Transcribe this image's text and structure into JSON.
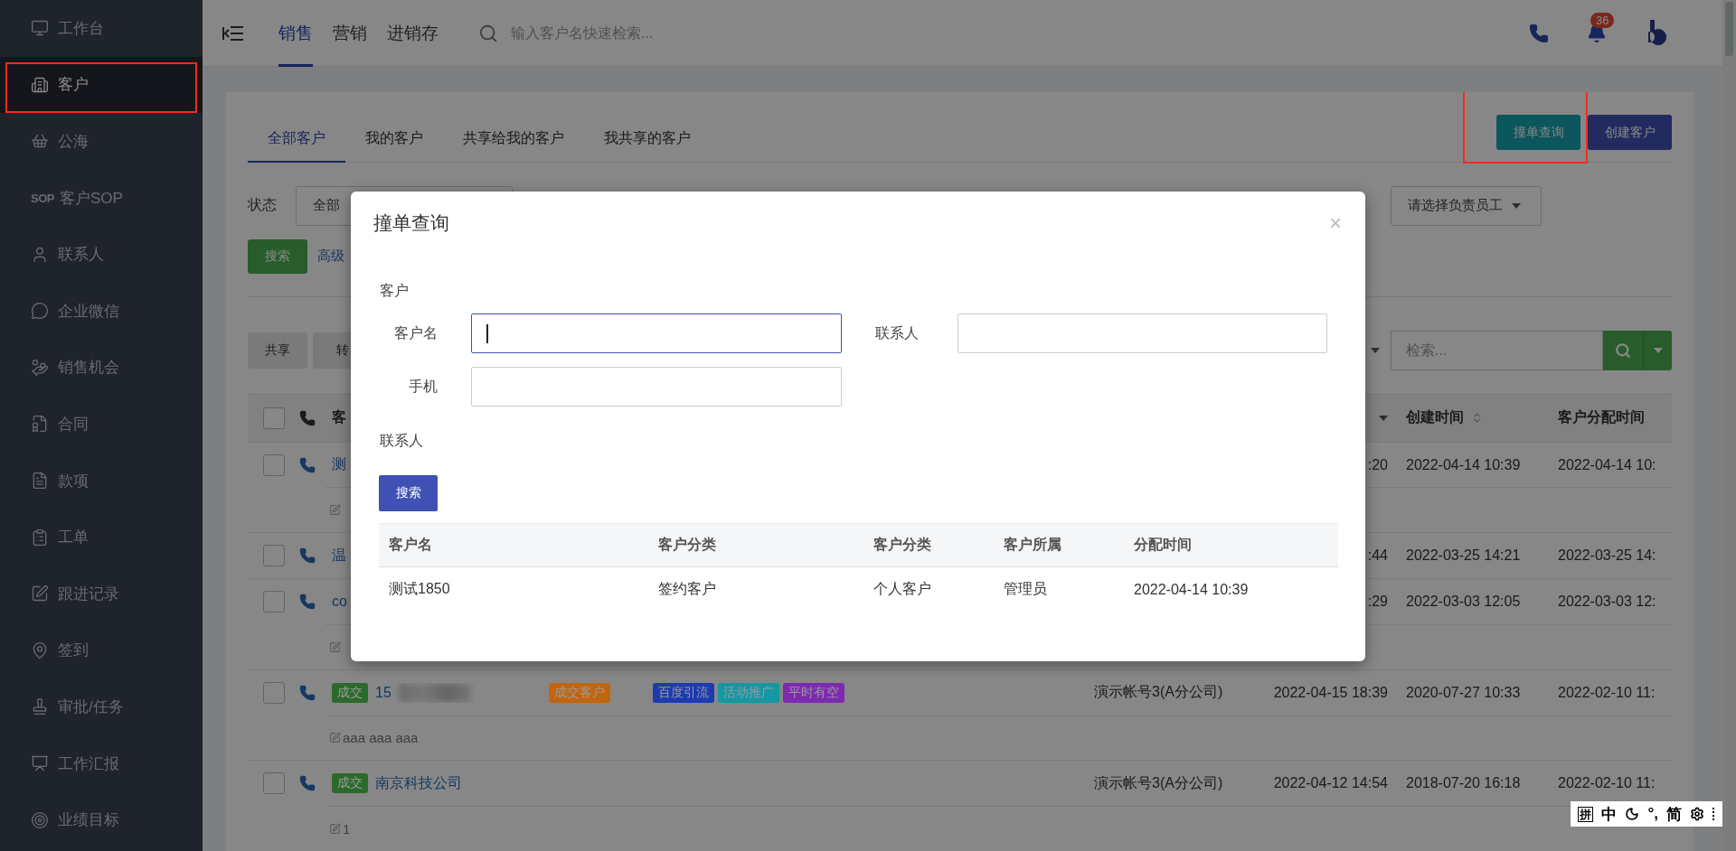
{
  "sidebar": {
    "items": [
      {
        "label": "工作台",
        "selected": false,
        "highlighted": false
      },
      {
        "label": "客户",
        "selected": true,
        "highlighted": true
      },
      {
        "label": "公海",
        "selected": false,
        "highlighted": false
      },
      {
        "label": "客户SOP",
        "icon_text": "SOP",
        "selected": false,
        "highlighted": false
      },
      {
        "label": "联系人",
        "selected": false,
        "highlighted": false
      },
      {
        "label": "企业微信",
        "selected": false,
        "highlighted": false
      },
      {
        "label": "销售机会",
        "selected": false,
        "highlighted": false
      },
      {
        "label": "合同",
        "selected": false,
        "highlighted": false
      },
      {
        "label": "款项",
        "selected": false,
        "highlighted": false
      },
      {
        "label": "工单",
        "selected": false,
        "highlighted": false
      },
      {
        "label": "跟进记录",
        "selected": false,
        "highlighted": false
      },
      {
        "label": "签到",
        "selected": false,
        "highlighted": false
      },
      {
        "label": "审批/任务",
        "selected": false,
        "highlighted": false
      },
      {
        "label": "工作汇报",
        "selected": false,
        "highlighted": false
      },
      {
        "label": "业绩目标",
        "selected": false,
        "highlighted": false
      }
    ]
  },
  "topbar": {
    "tabs": [
      {
        "label": "销售",
        "selected": true
      },
      {
        "label": "营销",
        "selected": false
      },
      {
        "label": "进销存",
        "selected": false
      }
    ],
    "search": {
      "placeholder": "输入客户名快速检索..."
    },
    "notification_count": "36"
  },
  "card": {
    "tabs": [
      {
        "label": "全部客户",
        "selected": true
      },
      {
        "label": "我的客户",
        "selected": false
      },
      {
        "label": "共享给我的客户",
        "selected": false
      },
      {
        "label": "我共享的客户",
        "selected": false
      }
    ],
    "actions": [
      {
        "label": "撞单查询",
        "kind": "teal",
        "highlighted": true
      },
      {
        "label": "创建客户",
        "kind": "indigo",
        "highlighted": false
      }
    ]
  },
  "filters": {
    "status_label": "状态",
    "status_value": "全部",
    "staff_select": "请选择负责员工",
    "search_button": "搜索",
    "advanced_link": "高级"
  },
  "toolbar": {
    "buttons": [
      "共享",
      "转"
    ],
    "search": {
      "placeholder": "检索..."
    }
  },
  "table": {
    "header": {
      "checked": false,
      "name": "客",
      "created": "创建时间",
      "assigned": "客户分配时间"
    },
    "rows": [
      {
        "checked": false,
        "name": "测",
        "follow_time": ":20",
        "created": "2022-04-14 10:39",
        "assigned": "2022-04-14 10:",
        "note_line": true
      },
      {
        "checked": false,
        "name": "温",
        "follow_time": ":44",
        "created": "2022-03-25 14:21",
        "assigned": "2022-03-25 14:",
        "note_line": false
      },
      {
        "checked": false,
        "name": "co",
        "follow_time": ":29",
        "created": "2022-03-03 12:05",
        "assigned": "2022-03-03 12:",
        "note_line": true
      },
      {
        "checked": false,
        "status": {
          "label": "成交",
          "color": "#2b6a2b"
        },
        "name": "15",
        "redacted": true,
        "category": {
          "label": "成交客户",
          "color": "#c2650f"
        },
        "tags": [
          {
            "label": "百度引流",
            "color": "#1c3bb0"
          },
          {
            "label": "活动推广",
            "color": "#1597a4"
          },
          {
            "label": "平时有空",
            "color": "#7d2ab0"
          }
        ],
        "owner": "演示帐号3(A分公司)",
        "follow_time": "2022-04-15 18:39",
        "created": "2020-07-27 10:33",
        "assigned": "2022-02-10 11:",
        "note_line": true,
        "note": "aaa aaa aaa"
      },
      {
        "checked": false,
        "status": {
          "label": "成交",
          "color": "#2b6a2b"
        },
        "name": "南京科技公司",
        "redacted": false,
        "owner": "演示帐号3(A分公司)",
        "follow_time": "2022-04-12 14:54",
        "created": "2018-07-20 16:18",
        "assigned": "2022-02-10 11:",
        "note_line": true,
        "note": "1"
      }
    ]
  },
  "dialog": {
    "title": "撞单查询",
    "close": "×",
    "customer_section": "客户",
    "fields": [
      {
        "label": "客户名",
        "focused": true
      },
      {
        "label": "联系人",
        "focused": false
      },
      {
        "label": "手机",
        "focused": false
      }
    ],
    "contact_section": "联系人",
    "search_button": "搜索",
    "results": {
      "columns": [
        "客户名",
        "客户分类",
        "客户分类",
        "客户所属",
        "分配时间"
      ],
      "rows": [
        [
          "测试1850",
          "签约客户",
          "个人客户",
          "管理员",
          "2022-04-14 10:39"
        ]
      ]
    }
  },
  "ime_bar": {
    "items": [
      {
        "kind": "boxed",
        "text": "拼"
      },
      {
        "kind": "text",
        "text": "中"
      },
      {
        "kind": "moon"
      },
      {
        "kind": "text",
        "text": "°,"
      },
      {
        "kind": "text",
        "text": "简"
      },
      {
        "kind": "gear"
      },
      {
        "kind": "grip"
      }
    ]
  }
}
